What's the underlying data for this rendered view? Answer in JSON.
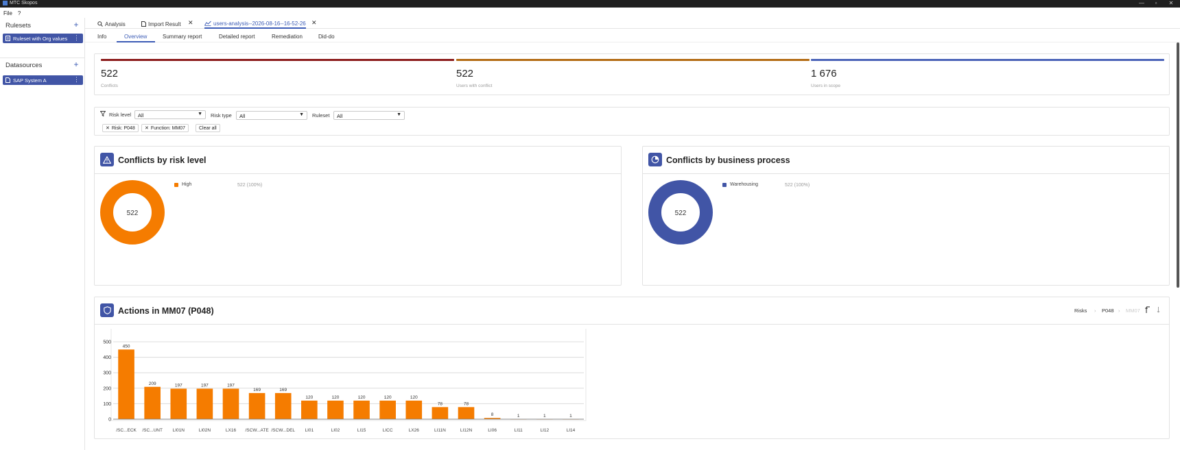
{
  "window": {
    "title": "MTC Skopos",
    "controls": [
      "—",
      "▫",
      "✕"
    ]
  },
  "menu": {
    "file": "File",
    "help": "?"
  },
  "sidebar": {
    "rulesets_heading": "Rulesets",
    "rulesets": [
      {
        "label": "Ruleset with Org values"
      }
    ],
    "datasources_heading": "Datasources",
    "datasources": [
      {
        "label": "SAP System A"
      }
    ],
    "add_symbol": "+",
    "kebab_symbol": "⋮"
  },
  "tabs": [
    {
      "label": "Analysis",
      "icon": "search-icon"
    },
    {
      "label": "Import Result",
      "icon": "document-icon",
      "closable": true
    },
    {
      "label": "users-analysis--2026-08-16--16-52-26",
      "icon": "chart-icon",
      "closable": true,
      "active": true
    }
  ],
  "close_symbol": "✕",
  "subtabs": [
    "Info",
    "Overview",
    "Summary report",
    "Detailed report",
    "Remediation",
    "Did-do"
  ],
  "active_subtab": "Overview",
  "kpis": [
    {
      "value": "522",
      "label": "Conflicts",
      "color": "#8b1a1a"
    },
    {
      "value": "522",
      "label": "Users with conflict",
      "color": "#b36a12"
    },
    {
      "value": "1 676",
      "label": "Users in scope",
      "color": "#4a63b8"
    }
  ],
  "filters": {
    "risk_level_label": "Risk level",
    "risk_level_value": "All",
    "risk_type_label": "Risk type",
    "risk_type_value": "All",
    "ruleset_label": "Ruleset",
    "ruleset_value": "All",
    "chips": [
      "Risk: P048",
      "Function: MM07"
    ],
    "clear_all": "Clear all"
  },
  "risk_panel": {
    "title": "Conflicts by risk level",
    "center": "522",
    "legend": [
      {
        "label": "High",
        "value": "522 (100%)",
        "color": "#f57c00"
      }
    ]
  },
  "process_panel": {
    "title": "Conflicts by business process",
    "center": "522",
    "legend": [
      {
        "label": "Warehousing",
        "value": "522 (100%)",
        "color": "#4155a6"
      }
    ]
  },
  "actions_panel": {
    "title": "Actions in MM07 (P048)",
    "breadcrumb": [
      "Risks",
      "P048",
      "MM07"
    ],
    "breadcrumb_sep": "›"
  },
  "chart_data": {
    "type": "bar",
    "categories": [
      "/SC...ECK",
      "/SC...UNT",
      "LI01N",
      "LI02N",
      "LX16",
      "/SCW...ATE",
      "/SCW...DEL",
      "LI01",
      "LI02",
      "LI15",
      "LICC",
      "LX26",
      "LI11N",
      "LI12N",
      "LI06",
      "LI11",
      "LI12",
      "LI14"
    ],
    "values": [
      450,
      209,
      197,
      197,
      197,
      169,
      169,
      120,
      120,
      120,
      120,
      120,
      78,
      78,
      8,
      1,
      1,
      1
    ],
    "ylim": [
      0,
      500
    ],
    "yticks": [
      0,
      100,
      200,
      300,
      400,
      500
    ],
    "color": "#f57c00",
    "grid": true,
    "title": "",
    "xlabel": "",
    "ylabel": ""
  }
}
